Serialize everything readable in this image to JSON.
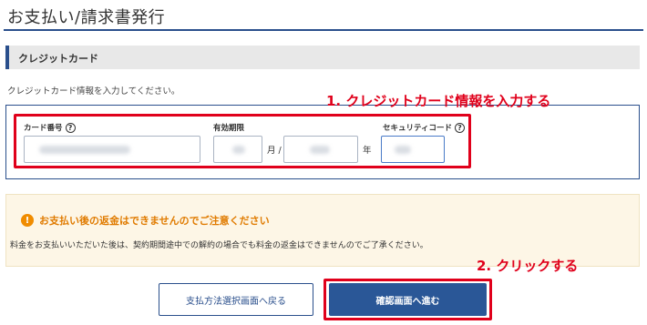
{
  "page": {
    "title": "お支払い/請求書発行"
  },
  "section": {
    "title": "クレジットカード"
  },
  "instruction": "クレジットカード情報を入力してください。",
  "fields": {
    "card_number_label": "カード番号",
    "expiry_label": "有効期限",
    "month_unit": "月 /",
    "year_unit": "年",
    "security_code_label": "セキュリティコード",
    "help_glyph": "?"
  },
  "annotations": {
    "step1": "1. クレジットカード情報を入力する",
    "step2": "2. クリックする"
  },
  "notice": {
    "icon": "!",
    "heading": "お支払い後の返金はできませんのでご注意ください",
    "body": "料金をお支払いいただいた後は、契約期間途中での解約の場合でも料金の返金はできませんのでご了承ください。"
  },
  "buttons": {
    "back_label": "支払方法選択画面へ戻る",
    "confirm_label": "確認画面へ進む"
  },
  "colors": {
    "brand": "#2a4f8c",
    "annotation": "#e0001b",
    "warning": "#e07b00"
  }
}
